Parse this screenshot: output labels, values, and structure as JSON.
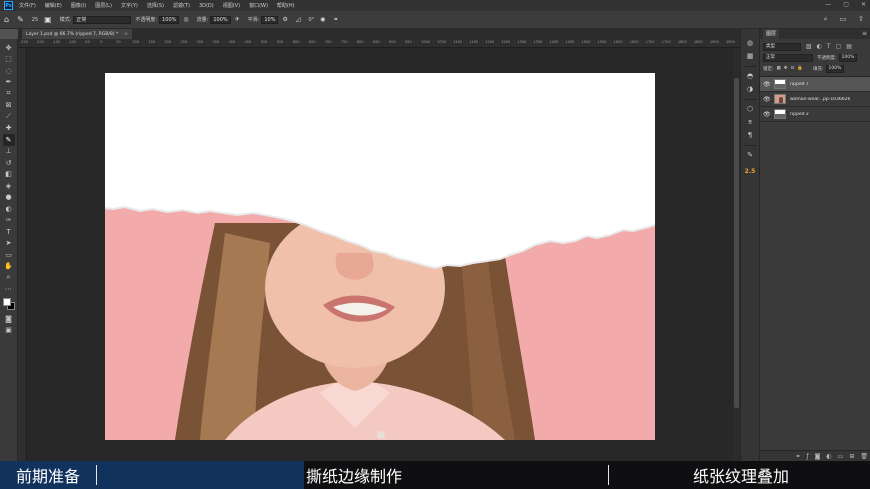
{
  "menu": {
    "app_icon": "Ps",
    "items": [
      "文件(F)",
      "编辑(E)",
      "图像(I)",
      "图层(L)",
      "文字(Y)",
      "选择(S)",
      "滤镜(T)",
      "3D(D)",
      "视图(V)",
      "窗口(W)",
      "帮助(H)"
    ]
  },
  "options": {
    "brush_size": "25",
    "mode_label": "模式:",
    "mode_value": "正常",
    "opacity_label": "不透明度:",
    "opacity_value": "100%",
    "flow_label": "流量:",
    "flow_value": "100%",
    "smooth_label": "平滑:",
    "smooth_value": "10%",
    "angle_value": "0°"
  },
  "document": {
    "tab_title": "Layer 1.psd @ 66.7% (ripped 7, RGB/8) *",
    "ruler_ticks": [
      "-250",
      "-200",
      "-150",
      "-100",
      "-50",
      "0",
      "50",
      "100",
      "150",
      "200",
      "250",
      "300",
      "350",
      "400",
      "450",
      "500",
      "550",
      "600",
      "650",
      "700",
      "750",
      "800",
      "850",
      "900",
      "950",
      "1000",
      "1050",
      "1100",
      "1150",
      "1200",
      "1250",
      "1300",
      "1350",
      "1400",
      "1450",
      "1500",
      "1550",
      "1600",
      "1650",
      "1700",
      "1750",
      "1800",
      "1850",
      "1900",
      "1950"
    ]
  },
  "layers_panel": {
    "tab_label": "图层",
    "kind_label": "类型",
    "blend_mode": "正常",
    "opacity_label": "不透明度:",
    "opacity_value": "100%",
    "lock_label": "锁定:",
    "fill_label": "填充:",
    "fill_value": "100%",
    "layers": [
      {
        "name": "ripped 7",
        "selected": true,
        "thumb": "paper"
      },
      {
        "name": "woman-wear...pp-1036626",
        "selected": false,
        "thumb": "photo"
      },
      {
        "name": "ripped 2",
        "selected": false,
        "thumb": "paper"
      }
    ]
  },
  "side_strip": {
    "number_badge": "2.5"
  },
  "captions": {
    "step_1": "前期准备",
    "step_2": "撕纸边缘制作",
    "step_3": "纸张纹理叠加"
  },
  "colors": {
    "canvas_pink": "#f2aaab",
    "caption_highlight": "#12325e",
    "ps_blue": "#31a8ff"
  }
}
